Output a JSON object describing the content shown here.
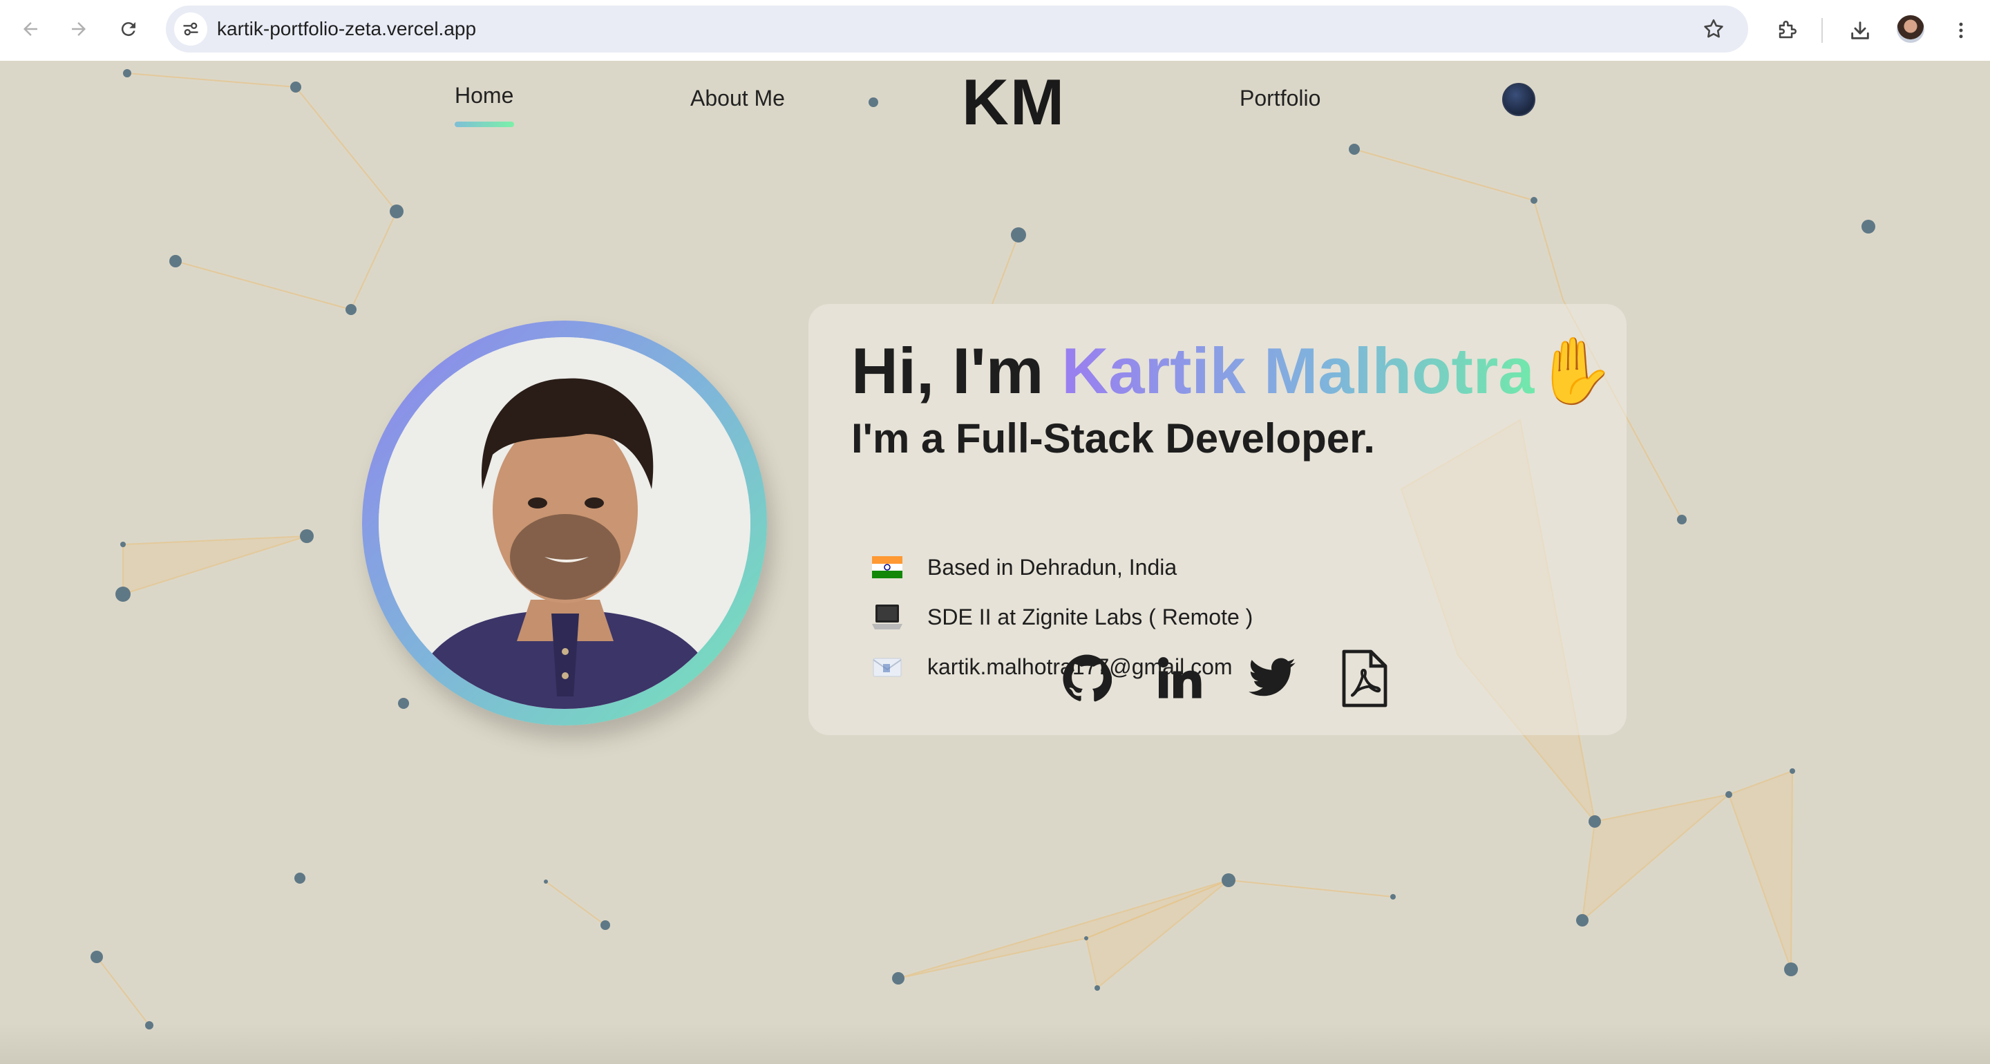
{
  "browser": {
    "url": "kartik-portfolio-zeta.vercel.app",
    "icons": [
      "back-icon",
      "forward-icon",
      "reload-icon",
      "site-info-icon",
      "bookmark-star-icon",
      "extensions-icon",
      "download-icon",
      "profile-avatar",
      "more-menu-icon"
    ]
  },
  "nav": {
    "home": "Home",
    "about": "About Me",
    "logo": "KM",
    "portfolio": "Portfolio"
  },
  "hero": {
    "greeting": "Hi, I'm ",
    "name": "Kartik Malhotra",
    "wave": "✋",
    "role": "I'm a Full-Stack Developer.",
    "info": [
      {
        "icon": "india-flag-icon",
        "text": "Based in Dehradun, India"
      },
      {
        "icon": "laptop-icon",
        "text": "SDE II at Zignite Labs ( Remote )"
      },
      {
        "icon": "envelope-icon",
        "text": "kartik.malhotra177@gmail.com"
      }
    ],
    "socials": [
      "github-icon",
      "linkedin-icon",
      "twitter-icon",
      "resume-pdf-icon"
    ]
  },
  "colors": {
    "background": "#dbd7c8",
    "gradient_start": "#9a7ef0",
    "gradient_mid": "#7fb3dd",
    "gradient_end": "#72e8ab",
    "particle": "#5f7886",
    "particle_line": "#e6c48c"
  }
}
